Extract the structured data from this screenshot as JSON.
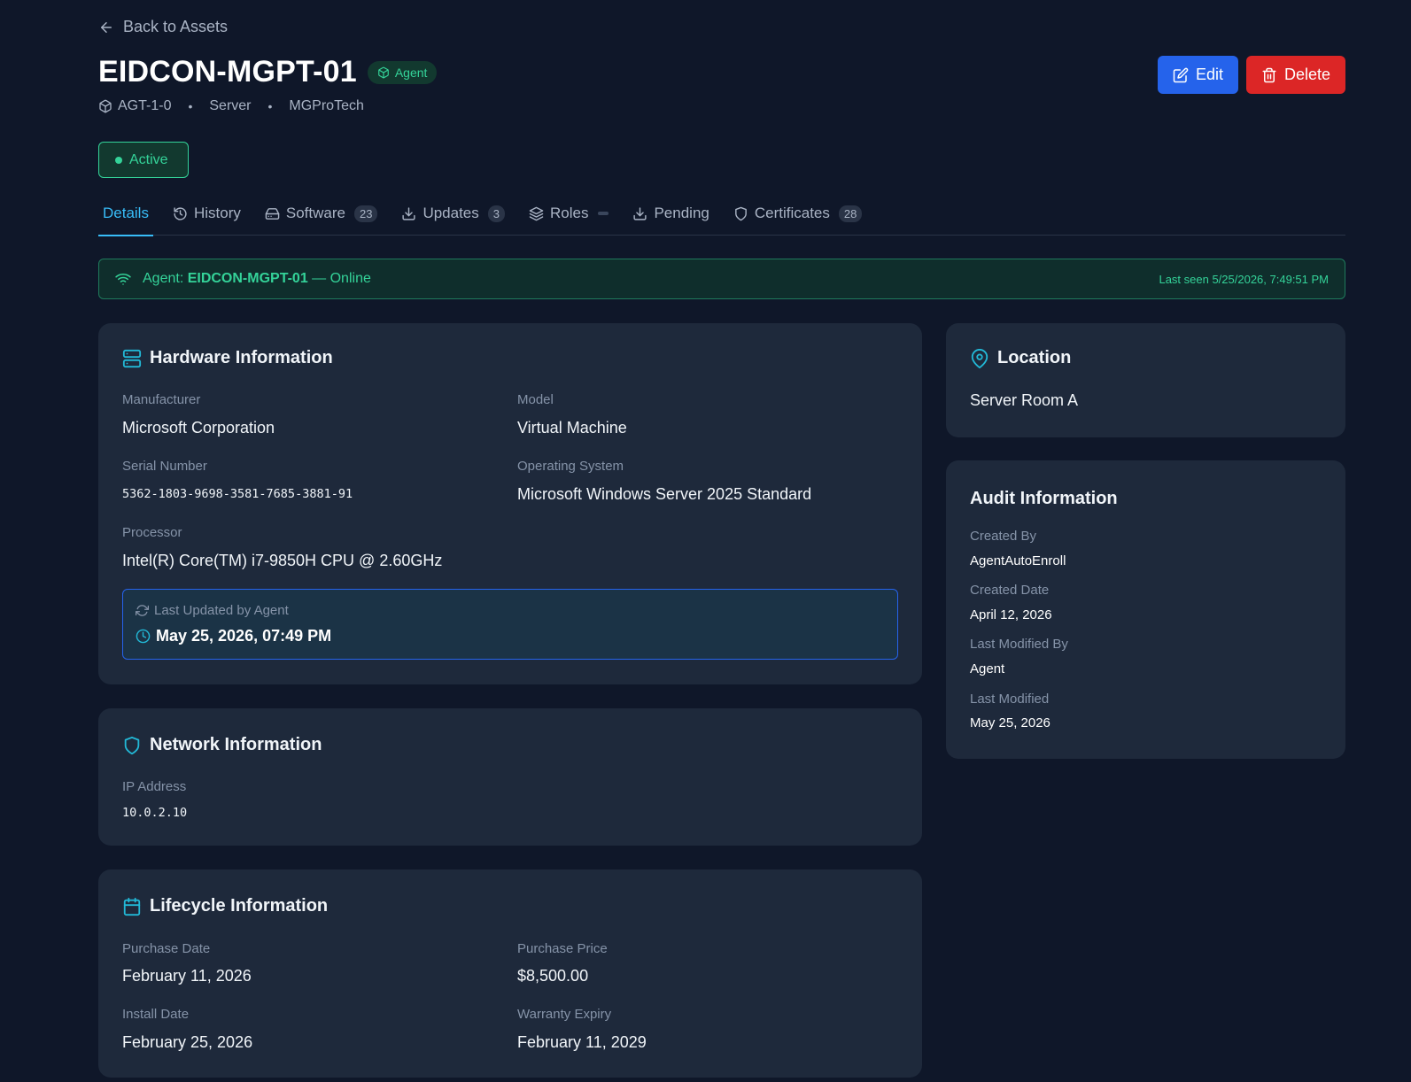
{
  "nav": {
    "back_label": "Back to Assets"
  },
  "header": {
    "title": "EIDCON-MGPT-01",
    "badge": "Agent",
    "asset_id": "AGT-1-0",
    "type": "Server",
    "vendor": "MGProTech",
    "separator": "•",
    "edit_label": "Edit",
    "delete_label": "Delete",
    "status": "Active"
  },
  "tabs": [
    {
      "label": "Details",
      "count": null,
      "active": true
    },
    {
      "label": "History",
      "count": null
    },
    {
      "label": "Software",
      "count": "23"
    },
    {
      "label": "Updates",
      "count": "3"
    },
    {
      "label": "Roles",
      "count": null
    },
    {
      "label": "Pending",
      "count": null
    },
    {
      "label": "Certificates",
      "count": "28"
    }
  ],
  "banner": {
    "prefix": "Agent: ",
    "agent_name": "EIDCON-MGPT-01",
    "suffix": " — Online",
    "last_seen": "Last seen 5/25/2026, 7:49:51 PM"
  },
  "hardware": {
    "title": "Hardware Information",
    "manufacturer_label": "Manufacturer",
    "manufacturer": "Microsoft Corporation",
    "model_label": "Model",
    "model": "Virtual Machine",
    "serial_label": "Serial Number",
    "serial": "5362-1803-9698-3581-7685-3881-91",
    "os_label": "Operating System",
    "os": "Microsoft Windows Server 2025 Standard",
    "processor_label": "Processor",
    "processor": "Intel(R) Core(TM) i7-9850H CPU @ 2.60GHz",
    "updated_label": "Last Updated by Agent",
    "updated_value": "May 25, 2026, 07:49 PM"
  },
  "network": {
    "title": "Network Information",
    "ip_label": "IP Address",
    "ip": "10.0.2.10"
  },
  "lifecycle": {
    "title": "Lifecycle Information",
    "purchase_date_label": "Purchase Date",
    "purchase_date": "February 11, 2026",
    "purchase_price_label": "Purchase Price",
    "purchase_price": "$8,500.00",
    "install_date_label": "Install Date",
    "install_date": "February 25, 2026",
    "warranty_label": "Warranty Expiry",
    "warranty": "February 11, 2029"
  },
  "location": {
    "title": "Location",
    "value": "Server Room A"
  },
  "audit": {
    "title": "Audit Information",
    "created_by_label": "Created By",
    "created_by": "AgentAutoEnroll",
    "created_date_label": "Created Date",
    "created_date": "April 12, 2026",
    "modified_by_label": "Last Modified By",
    "modified_by": "Agent",
    "modified_label": "Last Modified",
    "modified": "May 25, 2026"
  },
  "colors": {
    "background": "#0f1729",
    "card": "#1e293b",
    "accent": "#38bdf8",
    "success": "#34d399",
    "primary": "#2563eb",
    "danger": "#dc2626"
  },
  "icons": [
    "arrow-left-icon",
    "package-icon",
    "edit-icon",
    "trash-icon",
    "history-icon",
    "hard-drive-icon",
    "download-icon",
    "layers-icon",
    "shield-icon",
    "wifi-icon",
    "server-icon",
    "refresh-icon",
    "clock-icon",
    "map-pin-icon",
    "calendar-icon"
  ]
}
